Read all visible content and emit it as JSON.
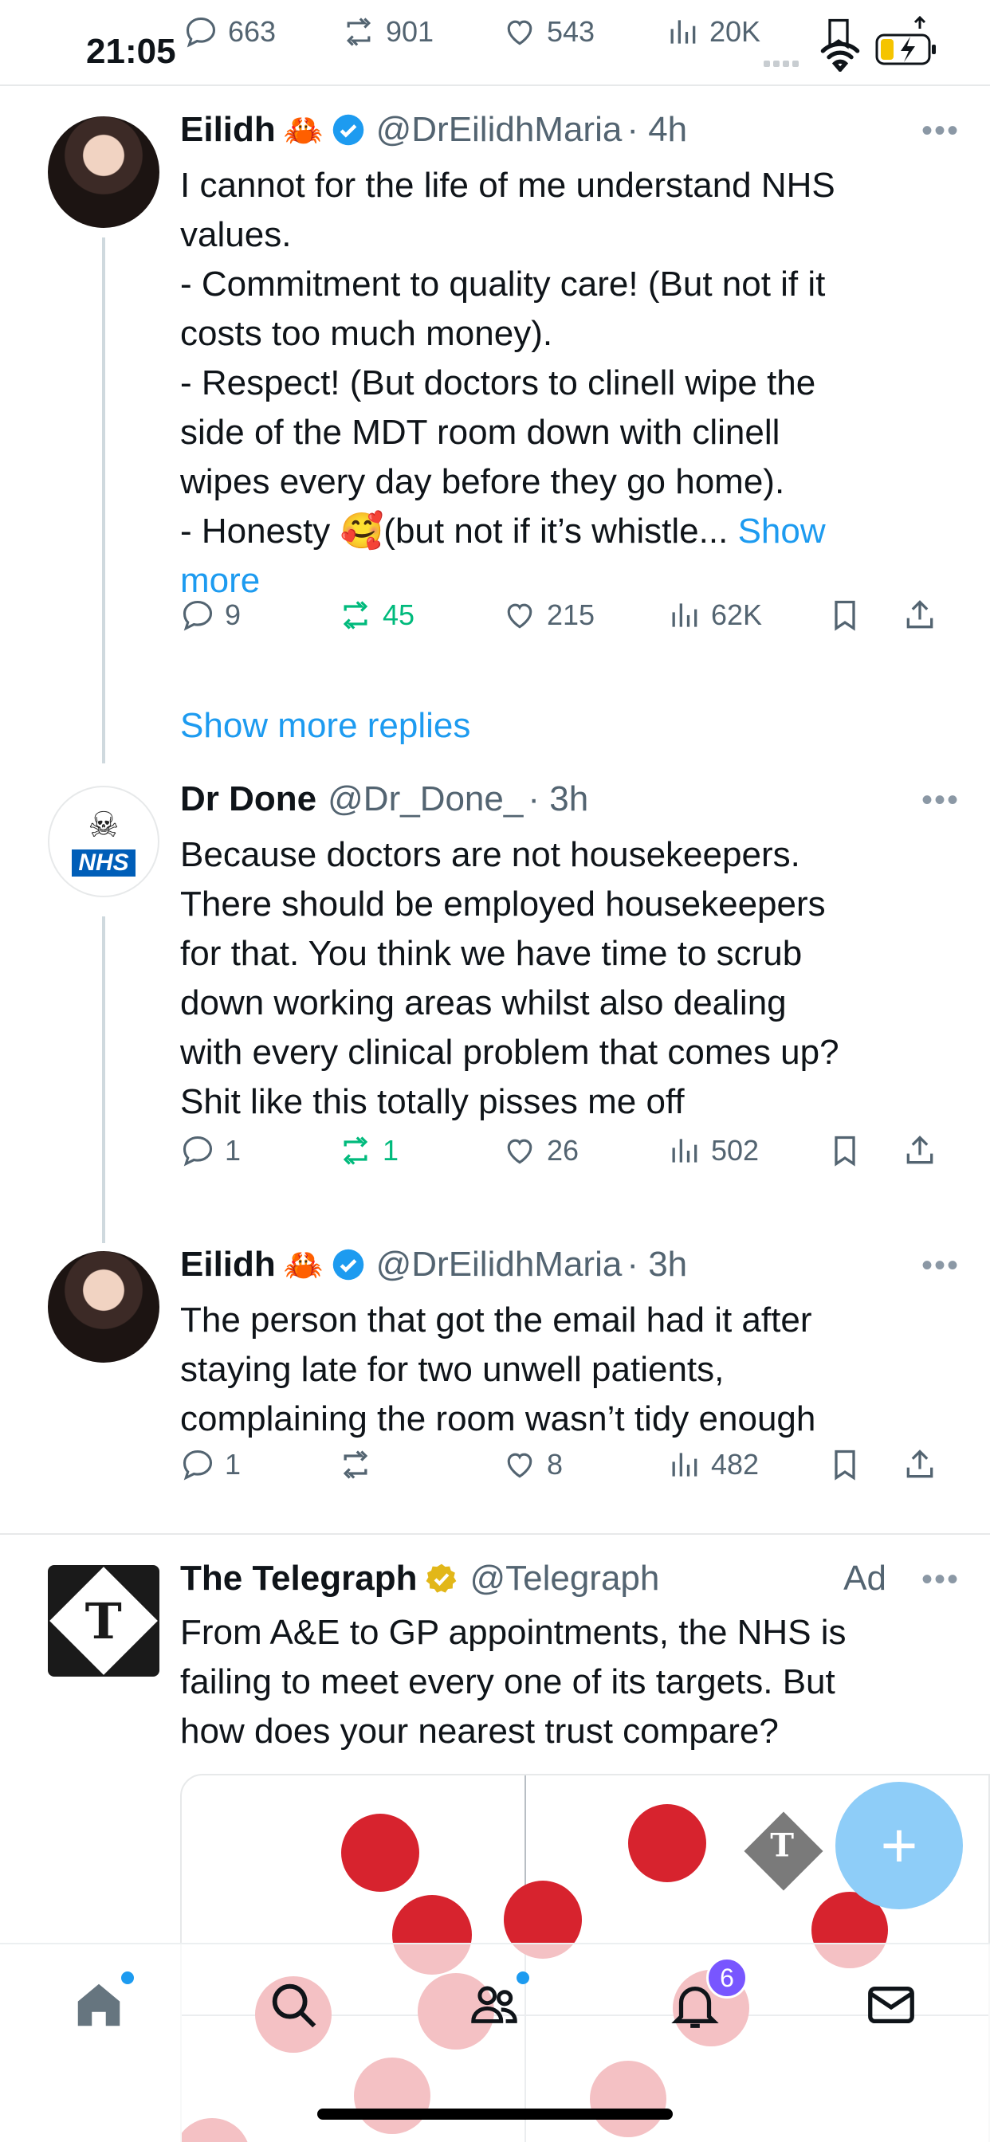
{
  "status_bar": {
    "time": "21:05",
    "metrics": {
      "replies": "663",
      "reposts": "901",
      "likes": "543",
      "views": "20K"
    }
  },
  "tweets": [
    {
      "name": "Eilidh",
      "emoji": "🦀",
      "verified": "blue",
      "handle": "@DrEilidhMaria",
      "time": "· 4h",
      "text_lines": [
        "I cannot for the life of me understand NHS",
        "values.",
        "- Commitment to quality care! (But not if it",
        "costs too much money).",
        "- Respect! (But doctors to clinell wipe the",
        "side of the MDT room down with clinell",
        "wipes every day before they go home).",
        "- Honesty 🥰(but not if it’s whistle... "
      ],
      "show_more": "Show",
      "show_more_2": "more",
      "replies": "9",
      "reposts": "45",
      "likes": "215",
      "views": "62K"
    },
    {
      "name": "Dr Done",
      "handle": "@Dr_Done_",
      "time": "· 3h",
      "avatar_text": "NHS",
      "text_lines": [
        "Because doctors are not housekeepers.",
        "There should be employed housekeepers",
        "for that. You think we have time to scrub",
        "down working areas whilst also dealing",
        "with every clinical problem that comes up?",
        "Shit like this totally pisses me off"
      ],
      "replies": "1",
      "reposts": "1",
      "likes": "26",
      "views": "502"
    },
    {
      "name": "Eilidh",
      "emoji": "🦀",
      "verified": "blue",
      "handle": "@DrEilidhMaria",
      "time": "· 3h",
      "text_lines": [
        "The person that got the email had it after",
        "staying late for two unwell patients,",
        "complaining the room wasn’t tidy enough"
      ],
      "replies": "1",
      "reposts": "",
      "likes": "8",
      "views": "482"
    }
  ],
  "show_more_replies": "Show more replies",
  "ad": {
    "name": "The Telegraph",
    "handle": "@Telegraph",
    "ad_label": "Ad",
    "avatar_letter": "T",
    "text_lines": [
      "From A&E to GP appointments, the NHS is",
      "failing to meet every one of its targets. But",
      "how does your nearest trust compare?"
    ]
  },
  "compose_label": "+",
  "tabbar": {
    "notifications_badge": "6"
  },
  "colors": {
    "accent": "#1d9bf0",
    "repost_green": "#00ba7c",
    "text_secondary": "#536471",
    "dot_red": "#d7232e"
  }
}
